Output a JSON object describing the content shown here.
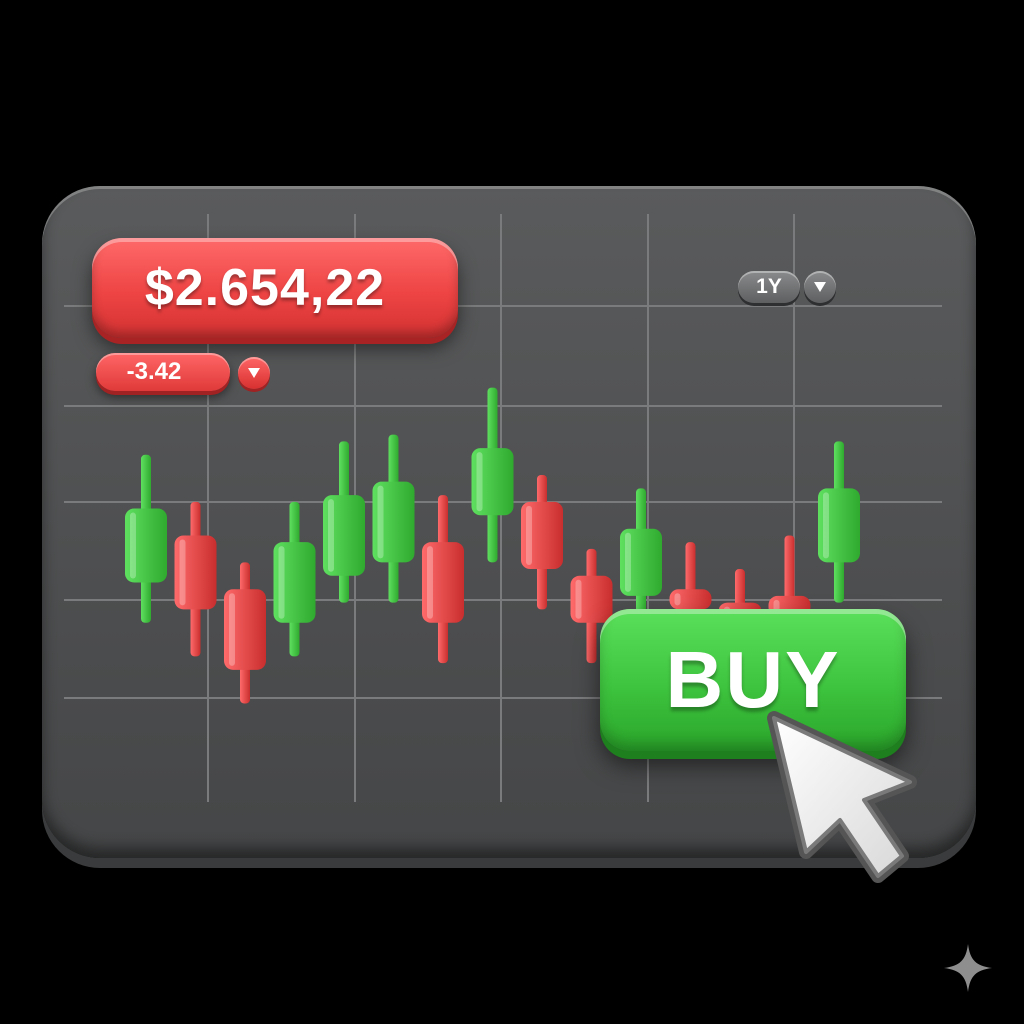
{
  "ticker": {
    "price_label": "$2.654,22",
    "change_label": "-3.42",
    "change_direction_icon": "triangle-down-icon",
    "period_label": "1Y",
    "period_dropdown_icon": "triangle-down-icon"
  },
  "actions": {
    "buy_label": "BUY"
  },
  "colors": {
    "up": "#3cc43c",
    "down": "#e84545",
    "panel": "#505152",
    "grid": "#7a7b7c"
  },
  "chart_data": {
    "type": "candlestick",
    "candles": [
      {
        "open": 41,
        "close": 52,
        "high": 60,
        "low": 35,
        "dir": "up"
      },
      {
        "open": 48,
        "close": 37,
        "high": 53,
        "low": 30,
        "dir": "down"
      },
      {
        "open": 40,
        "close": 28,
        "high": 44,
        "low": 23,
        "dir": "down"
      },
      {
        "open": 35,
        "close": 47,
        "high": 53,
        "low": 30,
        "dir": "up"
      },
      {
        "open": 42,
        "close": 54,
        "high": 62,
        "low": 38,
        "dir": "up"
      },
      {
        "open": 44,
        "close": 56,
        "high": 63,
        "low": 38,
        "dir": "up"
      },
      {
        "open": 47,
        "close": 35,
        "high": 54,
        "low": 29,
        "dir": "down"
      },
      {
        "open": 51,
        "close": 61,
        "high": 70,
        "low": 44,
        "dir": "up"
      },
      {
        "open": 53,
        "close": 43,
        "high": 57,
        "low": 37,
        "dir": "down"
      },
      {
        "open": 42,
        "close": 35,
        "high": 46,
        "low": 29,
        "dir": "down"
      },
      {
        "open": 39,
        "close": 49,
        "high": 55,
        "low": 36,
        "dir": "up"
      },
      {
        "open": 40,
        "close": 37,
        "high": 47,
        "low": 34,
        "dir": "down"
      },
      {
        "open": 38,
        "close": 36,
        "high": 43,
        "low": 34,
        "dir": "down"
      },
      {
        "open": 39,
        "close": 36,
        "high": 48,
        "low": 34,
        "dir": "down"
      },
      {
        "open": 44,
        "close": 55,
        "high": 62,
        "low": 38,
        "dir": "up"
      }
    ],
    "ylim": [
      0,
      100
    ],
    "grid": true
  }
}
